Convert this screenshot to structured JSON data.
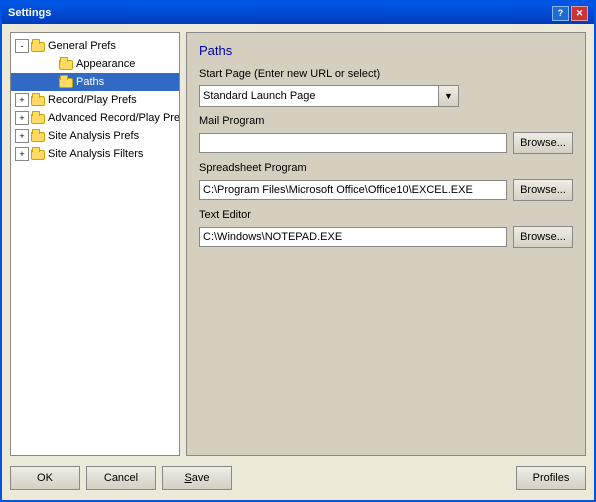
{
  "window": {
    "title": "Settings",
    "help_btn": "?",
    "close_btn": "✕"
  },
  "tree": {
    "items": [
      {
        "id": "general-prefs",
        "label": "General Prefs",
        "indent": 0,
        "expander": "-",
        "selected": false
      },
      {
        "id": "appearance",
        "label": "Appearance",
        "indent": 2,
        "expander": "",
        "selected": false
      },
      {
        "id": "paths",
        "label": "Paths",
        "indent": 2,
        "expander": "",
        "selected": true
      },
      {
        "id": "record-play-prefs",
        "label": "Record/Play Prefs",
        "indent": 0,
        "expander": "+",
        "selected": false
      },
      {
        "id": "advanced-record-play",
        "label": "Advanced Record/Play Prefs",
        "indent": 0,
        "expander": "+",
        "selected": false
      },
      {
        "id": "site-analysis-prefs",
        "label": "Site Analysis Prefs",
        "indent": 0,
        "expander": "+",
        "selected": false
      },
      {
        "id": "site-analysis-filters",
        "label": "Site Analysis Filters",
        "indent": 0,
        "expander": "+",
        "selected": false
      }
    ]
  },
  "panel": {
    "title": "Paths",
    "sections": [
      {
        "id": "start-page",
        "label": "Start Page (Enter new URL or select)",
        "type": "dropdown",
        "value": "Standard Launch Page",
        "options": [
          "Standard Launch Page"
        ]
      },
      {
        "id": "mail-program",
        "label": "Mail Program",
        "type": "browse",
        "value": "",
        "browse_label": "Browse..."
      },
      {
        "id": "spreadsheet-program",
        "label": "Spreadsheet Program",
        "type": "browse",
        "value": "C:\\Program Files\\Microsoft Office\\Office10\\EXCEL.EXE",
        "browse_label": "Browse..."
      },
      {
        "id": "text-editor",
        "label": "Text Editor",
        "type": "browse",
        "value": "C:\\Windows\\NOTEPAD.EXE",
        "browse_label": "Browse..."
      }
    ]
  },
  "buttons": {
    "ok": "OK",
    "cancel": "Cancel",
    "save": "Save",
    "profiles": "Profiles"
  }
}
